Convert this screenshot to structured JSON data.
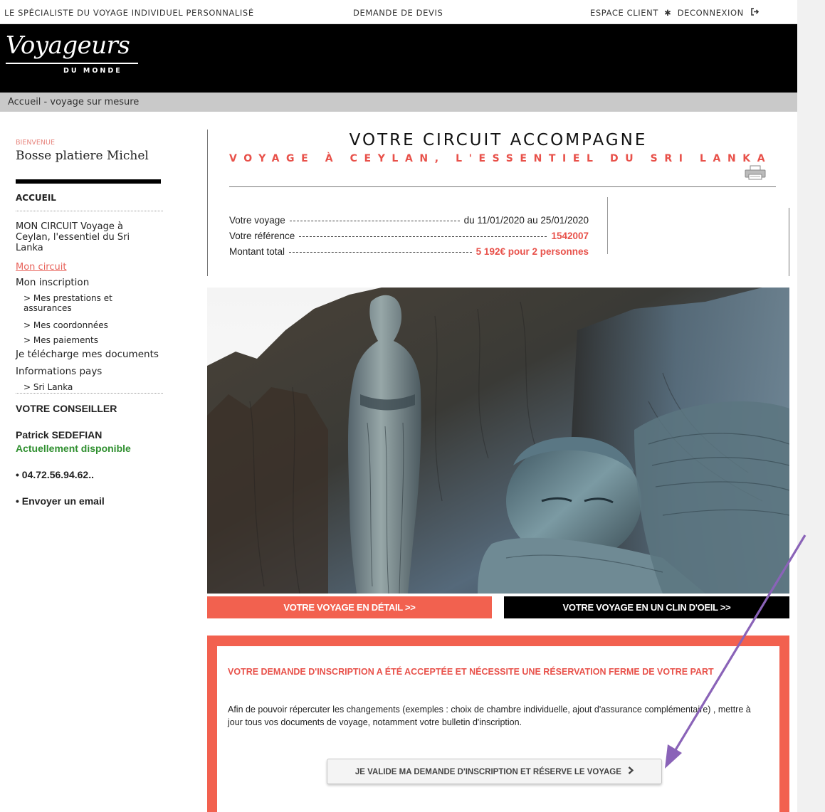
{
  "topbar": {
    "tagline": "LE SPÉCIALISTE DU VOYAGE INDIVIDUEL PERSONNALISÉ",
    "quote": "DEMANDE DE DEVIS",
    "client_space": "ESPACE CLIENT",
    "separator": "✱",
    "logout": "DECONNEXION",
    "logout_icon": "logout-icon"
  },
  "brand": {
    "name": "Voyageurs",
    "sub": "DU MONDE"
  },
  "breadcrumb": "Accueil - voyage sur mesure",
  "sidebar": {
    "welcome": "BIENVENUE",
    "user": "Bosse platiere Michel",
    "home": "ACCUEIL",
    "circuit": "MON CIRCUIT Voyage à Ceylan, l'essentiel du Sri Lanka",
    "mon_circuit": "Mon circuit",
    "inscription": "Mon inscription",
    "prestations": "> Mes prestations et assurances",
    "coordonnees": "> Mes coordonnées",
    "paiements": "> Mes paiements",
    "documents": "Je télécharge mes documents",
    "infos_pays": "Informations pays",
    "sri_lanka": "> Sri Lanka",
    "conseiller_title": "VOTRE CONSEILLER",
    "conseiller_name": "Patrick SEDEFIAN",
    "availability": "Actuellement disponible",
    "phone": "• 04.72.56.94.62..",
    "email": "• Envoyer un email"
  },
  "main": {
    "title": "VOTRE CIRCUIT ACCOMPAGNE",
    "subtitle": "VOYAGE À CEYLAN, L'ESSENTIEL DU SRI LANKA",
    "trip_label": "Votre voyage",
    "trip_value": "du 11/01/2020 au 25/01/2020",
    "ref_label": "Votre référence",
    "ref_value": "1542007",
    "total_label": "Montant total",
    "total_value": "5 192€ pour 2 personnes",
    "btn_detail": "VOTRE VOYAGE EN DÉTAIL >>",
    "btn_clin": "VOTRE VOYAGE EN UN CLIN D'OEIL >>"
  },
  "alert": {
    "title": "VOTRE DEMANDE D'INSCRIPTION A ÉTÉ ACCEPTÉE ET NÉCESSITE UNE RÉSERVATION FERME DE VOTRE PART",
    "text": "Afin de pouvoir répercuter les changements (exemples : choix de chambre individuelle, ajout d'assurance complémentaire) , mettre à jour tous vos documents de voyage, notamment votre bulletin d'inscription.",
    "button": "JE VALIDE MA DEMANDE D'INSCRIPTION ET RÉSERVE LE VOYAGE"
  },
  "colors": {
    "accent": "#f2614f",
    "accent_text": "#e8514a",
    "available": "#2f8f2f",
    "annotation": "#8a63b8"
  }
}
